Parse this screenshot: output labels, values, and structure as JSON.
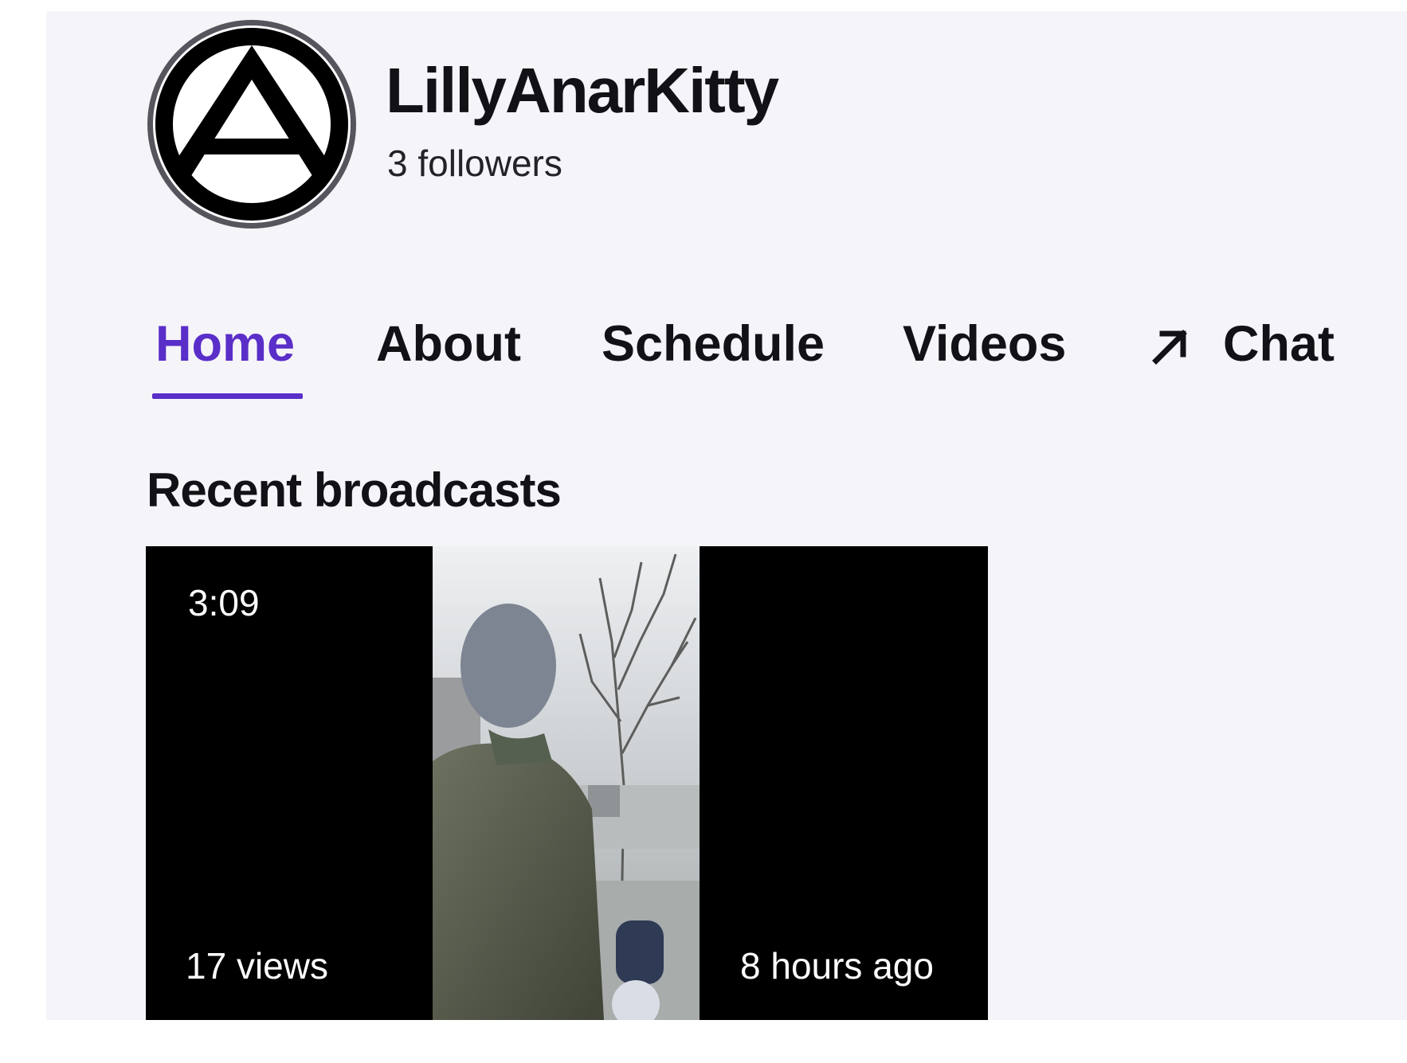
{
  "channel": {
    "name": "LillyAnarKitty",
    "followers": "3 followers",
    "avatar_icon": "anarchy-symbol-icon"
  },
  "tabs": [
    {
      "label": "Home",
      "active": true
    },
    {
      "label": "About",
      "active": false
    },
    {
      "label": "Schedule",
      "active": false
    },
    {
      "label": "Videos",
      "active": false
    },
    {
      "label": "Chat",
      "active": false,
      "icon": "external-arrow-icon"
    }
  ],
  "section": {
    "title": "Recent broadcasts"
  },
  "broadcast": {
    "duration": "3:09",
    "views": "17 views",
    "age": "8 hours ago"
  },
  "colors": {
    "accent": "#5a2ec8",
    "background": "#f5f4f9",
    "text": "#111116"
  }
}
